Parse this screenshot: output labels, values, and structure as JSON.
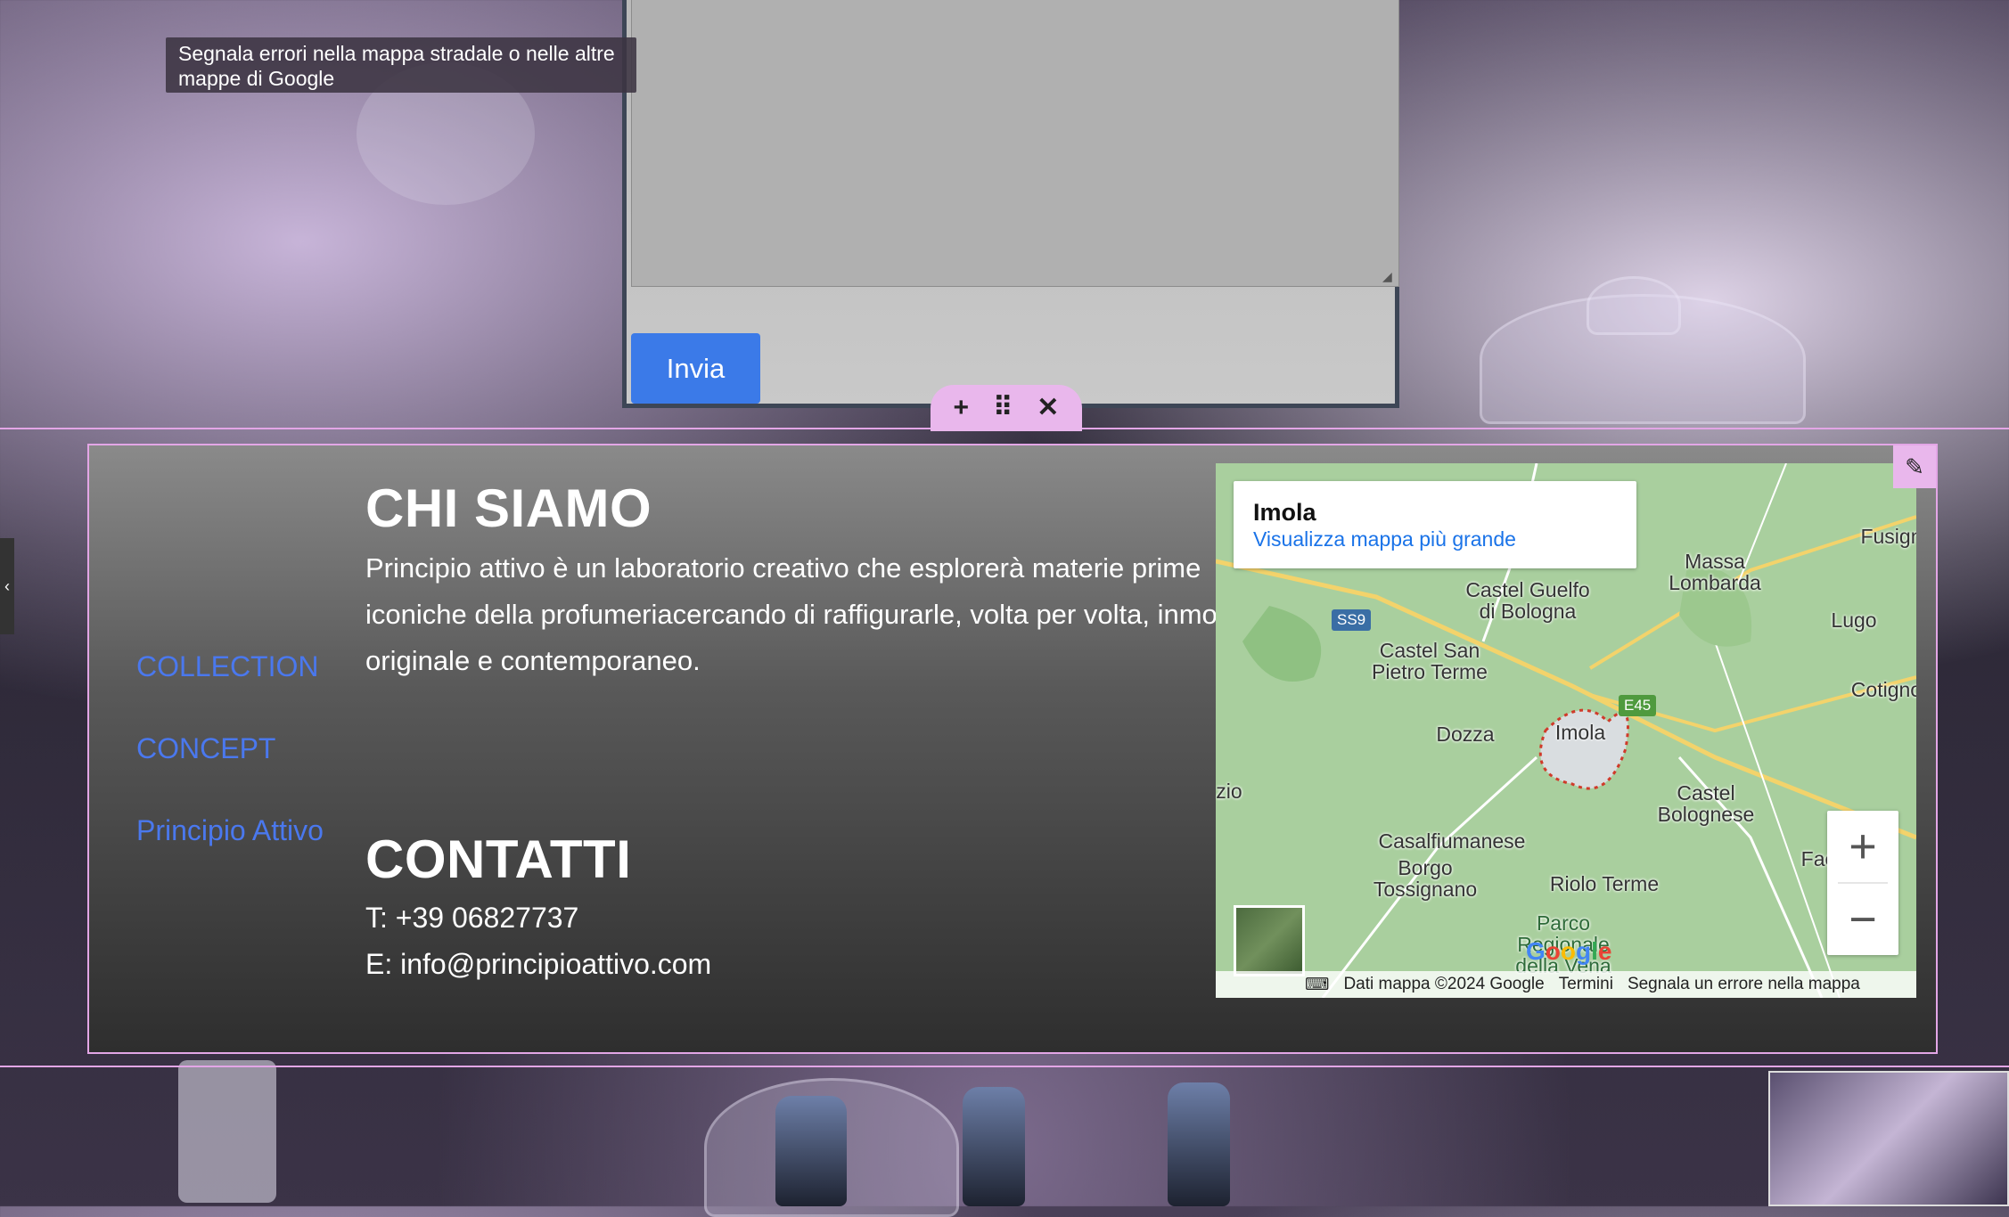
{
  "tooltip": {
    "line1": "Segnala errori nella mappa stradale o nelle altre",
    "line2": "mappe di Google"
  },
  "form": {
    "send_label": "Invia"
  },
  "toolbar": {
    "add_icon": "+",
    "drag_icon": "⠿",
    "close_icon": "✕"
  },
  "nav": {
    "items": [
      {
        "label": "COLLECTION"
      },
      {
        "label": "CONCEPT"
      },
      {
        "label": "Principio Attivo"
      }
    ],
    "color": "#4a78ee"
  },
  "about": {
    "title": "CHI SIAMO",
    "text": "Principio attivo  è un laboratorio creativo che esplorerà materie prime  iconiche della profumeriacercando di raffigurarle, volta per volta, inmodo originale e contemporaneo."
  },
  "contacts": {
    "title": "CONTATTI",
    "phone": "T: +39 06827737",
    "email": "E: info@principioattivo.com"
  },
  "map": {
    "card_title": "Imola",
    "card_link": "Visualizza mappa più grande",
    "places": [
      "Castel Guelfo di Bologna",
      "Massa Lombarda",
      "Fusign",
      "Lugo",
      "Castel San Pietro Terme",
      "Cotignol",
      "Dozza",
      "Imola",
      "Castel Bolognese",
      "Casalfiumanese",
      "Borgo Tossignano",
      "Riolo Terme",
      "Faenza",
      "Parco Regionale della Vena",
      "zio"
    ],
    "road_labels": [
      "SS9",
      "E45"
    ],
    "footer_data": "Dati mappa ©2024 Google",
    "footer_terms": "Termini",
    "footer_report": "Segnala un errore nella mappa",
    "google_logo": "Google",
    "zoom_in": "+",
    "zoom_out": "−"
  },
  "colors": {
    "accent": "#3b7ae8",
    "editor_highlight": "#e3a6e6",
    "link": "#1a73e8"
  }
}
